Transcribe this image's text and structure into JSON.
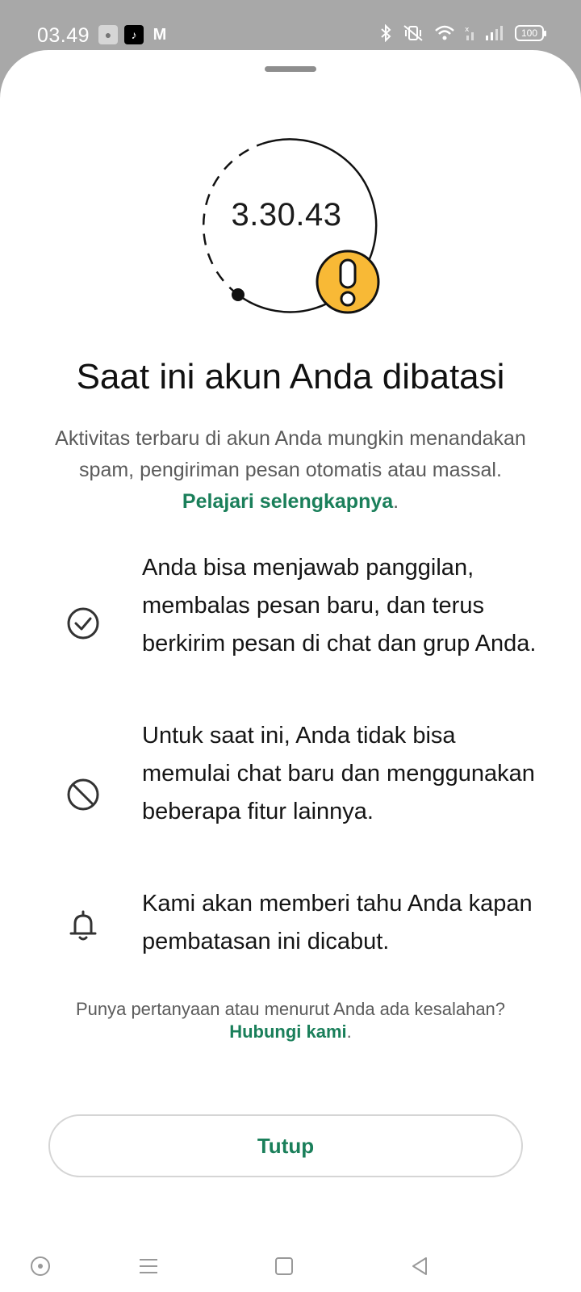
{
  "status_bar": {
    "time": "03.49",
    "battery": "100",
    "left_icons": [
      "photo-app-icon",
      "tiktok-icon",
      "gmail-icon"
    ],
    "right_icons": [
      "bluetooth-icon",
      "vibrate-icon",
      "wifi-icon",
      "signal-icon",
      "battery-icon"
    ]
  },
  "timer": {
    "value": "3.30.43",
    "warning_color": "#f8b936"
  },
  "title": "Saat ini akun Anda dibatasi",
  "description": {
    "text": "Aktivitas terbaru di akun Anda mungkin menandakan spam, pengiriman pesan otomatis atau massal. ",
    "link": "Pelajari selengkapnya",
    "trailing": "."
  },
  "info_items": [
    {
      "icon": "check-circle-icon",
      "text": "Anda bisa menjawab panggilan, membalas pesan baru, dan terus berkirim pesan di chat dan grup Anda."
    },
    {
      "icon": "block-icon",
      "text": "Untuk saat ini, Anda tidak bisa memulai chat baru dan menggunakan beberapa fitur lainnya."
    },
    {
      "icon": "bell-icon",
      "text": "Kami akan memberi tahu Anda kapan pembatasan ini dicabut."
    }
  ],
  "footer": {
    "question": "Punya pertanyaan atau menurut Anda ada kesalahan?",
    "link": "Hubungi kami",
    "trailing": "."
  },
  "close_button": "Tutup",
  "colors": {
    "accent": "#1a7f5a",
    "warning": "#f8b936"
  }
}
